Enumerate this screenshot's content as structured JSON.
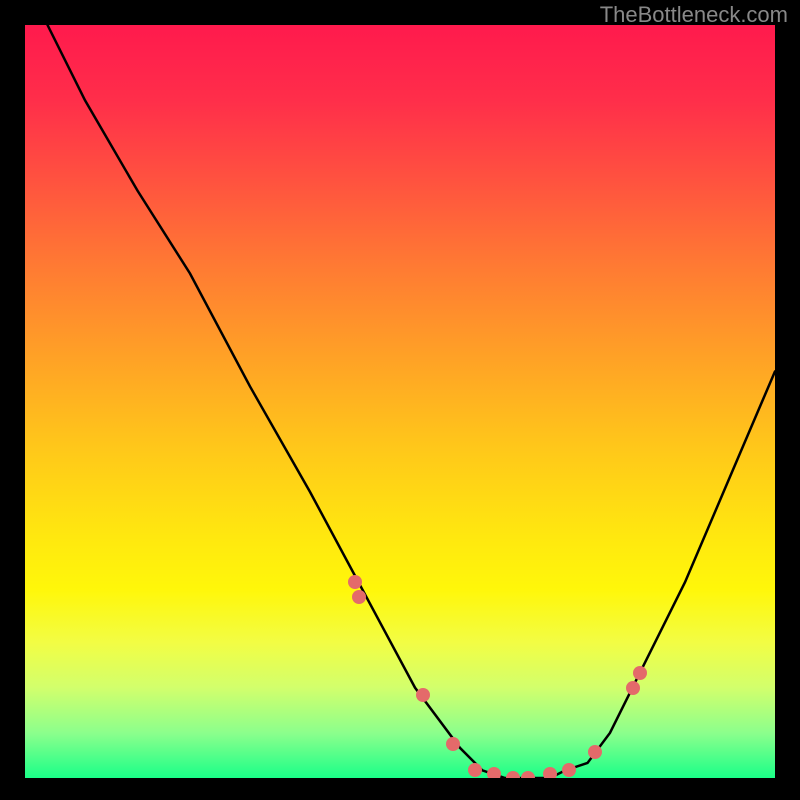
{
  "watermark": "TheBottleneck.com",
  "chart_data": {
    "type": "line",
    "title": "",
    "xlabel": "",
    "ylabel": "",
    "xlim": [
      0,
      100
    ],
    "ylim": [
      0,
      100
    ],
    "grid": false,
    "series": [
      {
        "name": "curve",
        "color": "#000000",
        "x": [
          3,
          8,
          15,
          22,
          30,
          38,
          45,
          52,
          58,
          61,
          64,
          67,
          70,
          72,
          75,
          78,
          82,
          88,
          94,
          100
        ],
        "y": [
          100,
          90,
          78,
          67,
          52,
          38,
          25,
          12,
          4,
          1,
          0,
          0,
          0,
          1,
          2,
          6,
          14,
          26,
          40,
          54
        ]
      }
    ],
    "markers": {
      "name": "highlight-dots",
      "color": "#e46a6a",
      "x": [
        44,
        44.5,
        53,
        57,
        60,
        62.5,
        65,
        67,
        70,
        72.5,
        76,
        81,
        82
      ],
      "y": [
        26,
        24,
        11,
        4.5,
        1,
        0.5,
        0,
        0,
        0.5,
        1,
        3.5,
        12,
        14
      ]
    },
    "background_gradient": {
      "top": "#ff1a4d",
      "bottom": "#1aff88"
    }
  }
}
